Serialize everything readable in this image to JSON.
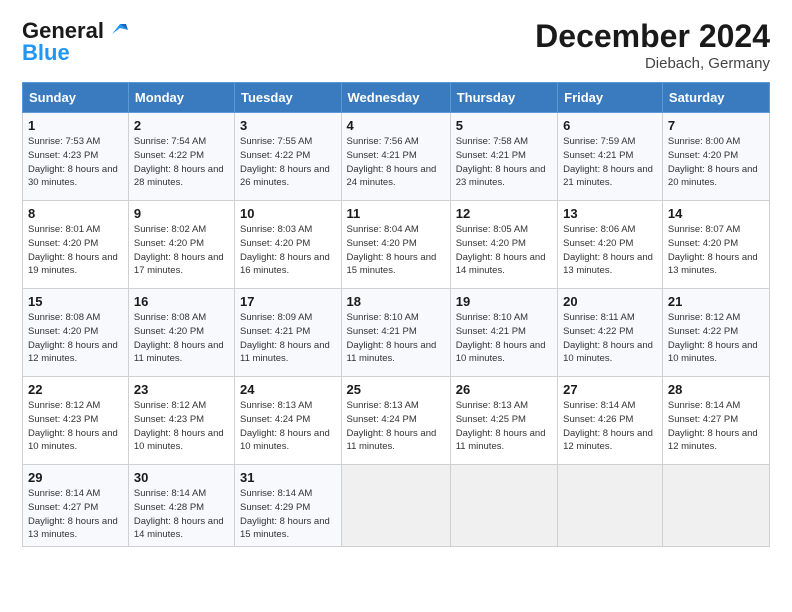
{
  "logo": {
    "line1": "General",
    "line2": "Blue"
  },
  "title": "December 2024",
  "subtitle": "Diebach, Germany",
  "weekdays": [
    "Sunday",
    "Monday",
    "Tuesday",
    "Wednesday",
    "Thursday",
    "Friday",
    "Saturday"
  ],
  "weeks": [
    [
      {
        "day": "1",
        "sunrise": "7:53 AM",
        "sunset": "4:23 PM",
        "daylight": "8 hours and 30 minutes."
      },
      {
        "day": "2",
        "sunrise": "7:54 AM",
        "sunset": "4:22 PM",
        "daylight": "8 hours and 28 minutes."
      },
      {
        "day": "3",
        "sunrise": "7:55 AM",
        "sunset": "4:22 PM",
        "daylight": "8 hours and 26 minutes."
      },
      {
        "day": "4",
        "sunrise": "7:56 AM",
        "sunset": "4:21 PM",
        "daylight": "8 hours and 24 minutes."
      },
      {
        "day": "5",
        "sunrise": "7:58 AM",
        "sunset": "4:21 PM",
        "daylight": "8 hours and 23 minutes."
      },
      {
        "day": "6",
        "sunrise": "7:59 AM",
        "sunset": "4:21 PM",
        "daylight": "8 hours and 21 minutes."
      },
      {
        "day": "7",
        "sunrise": "8:00 AM",
        "sunset": "4:20 PM",
        "daylight": "8 hours and 20 minutes."
      }
    ],
    [
      {
        "day": "8",
        "sunrise": "8:01 AM",
        "sunset": "4:20 PM",
        "daylight": "8 hours and 19 minutes."
      },
      {
        "day": "9",
        "sunrise": "8:02 AM",
        "sunset": "4:20 PM",
        "daylight": "8 hours and 17 minutes."
      },
      {
        "day": "10",
        "sunrise": "8:03 AM",
        "sunset": "4:20 PM",
        "daylight": "8 hours and 16 minutes."
      },
      {
        "day": "11",
        "sunrise": "8:04 AM",
        "sunset": "4:20 PM",
        "daylight": "8 hours and 15 minutes."
      },
      {
        "day": "12",
        "sunrise": "8:05 AM",
        "sunset": "4:20 PM",
        "daylight": "8 hours and 14 minutes."
      },
      {
        "day": "13",
        "sunrise": "8:06 AM",
        "sunset": "4:20 PM",
        "daylight": "8 hours and 13 minutes."
      },
      {
        "day": "14",
        "sunrise": "8:07 AM",
        "sunset": "4:20 PM",
        "daylight": "8 hours and 13 minutes."
      }
    ],
    [
      {
        "day": "15",
        "sunrise": "8:08 AM",
        "sunset": "4:20 PM",
        "daylight": "8 hours and 12 minutes."
      },
      {
        "day": "16",
        "sunrise": "8:08 AM",
        "sunset": "4:20 PM",
        "daylight": "8 hours and 11 minutes."
      },
      {
        "day": "17",
        "sunrise": "8:09 AM",
        "sunset": "4:21 PM",
        "daylight": "8 hours and 11 minutes."
      },
      {
        "day": "18",
        "sunrise": "8:10 AM",
        "sunset": "4:21 PM",
        "daylight": "8 hours and 11 minutes."
      },
      {
        "day": "19",
        "sunrise": "8:10 AM",
        "sunset": "4:21 PM",
        "daylight": "8 hours and 10 minutes."
      },
      {
        "day": "20",
        "sunrise": "8:11 AM",
        "sunset": "4:22 PM",
        "daylight": "8 hours and 10 minutes."
      },
      {
        "day": "21",
        "sunrise": "8:12 AM",
        "sunset": "4:22 PM",
        "daylight": "8 hours and 10 minutes."
      }
    ],
    [
      {
        "day": "22",
        "sunrise": "8:12 AM",
        "sunset": "4:23 PM",
        "daylight": "8 hours and 10 minutes."
      },
      {
        "day": "23",
        "sunrise": "8:12 AM",
        "sunset": "4:23 PM",
        "daylight": "8 hours and 10 minutes."
      },
      {
        "day": "24",
        "sunrise": "8:13 AM",
        "sunset": "4:24 PM",
        "daylight": "8 hours and 10 minutes."
      },
      {
        "day": "25",
        "sunrise": "8:13 AM",
        "sunset": "4:24 PM",
        "daylight": "8 hours and 11 minutes."
      },
      {
        "day": "26",
        "sunrise": "8:13 AM",
        "sunset": "4:25 PM",
        "daylight": "8 hours and 11 minutes."
      },
      {
        "day": "27",
        "sunrise": "8:14 AM",
        "sunset": "4:26 PM",
        "daylight": "8 hours and 12 minutes."
      },
      {
        "day": "28",
        "sunrise": "8:14 AM",
        "sunset": "4:27 PM",
        "daylight": "8 hours and 12 minutes."
      }
    ],
    [
      {
        "day": "29",
        "sunrise": "8:14 AM",
        "sunset": "4:27 PM",
        "daylight": "8 hours and 13 minutes."
      },
      {
        "day": "30",
        "sunrise": "8:14 AM",
        "sunset": "4:28 PM",
        "daylight": "8 hours and 14 minutes."
      },
      {
        "day": "31",
        "sunrise": "8:14 AM",
        "sunset": "4:29 PM",
        "daylight": "8 hours and 15 minutes."
      },
      null,
      null,
      null,
      null
    ]
  ]
}
